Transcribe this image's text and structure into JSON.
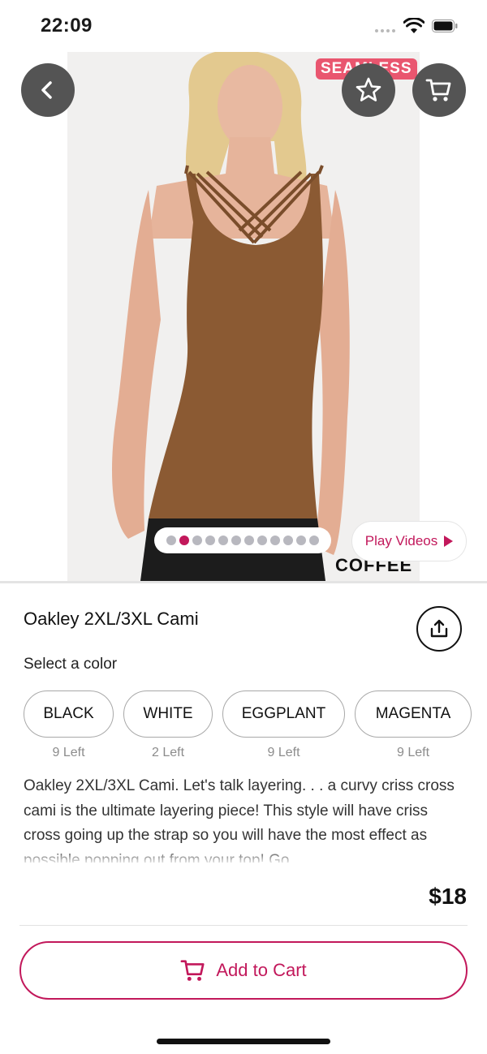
{
  "status_bar": {
    "time": "22:09"
  },
  "hero": {
    "image_tag": "SEAMLESS",
    "image_color_label": "COFFEE",
    "icons": {
      "back": "chevron-left-icon",
      "favorite": "star-icon",
      "cart": "cart-icon"
    },
    "carousel": {
      "total": 12,
      "active_index": 1
    },
    "play_videos_label": "Play Videos"
  },
  "product": {
    "title": "Oakley 2XL/3XL Cami",
    "select_color_label": "Select a color",
    "colors": [
      {
        "name": "BLACK",
        "stock": "9 Left"
      },
      {
        "name": "WHITE",
        "stock": "2 Left"
      },
      {
        "name": "EGGPLANT",
        "stock": "9 Left"
      },
      {
        "name": "MAGENTA",
        "stock": "9 Left"
      }
    ],
    "description": "Oakley 2XL/3XL Cami. Let's talk layering. . . a curvy criss cross cami is the ultimate layering piece! This style will have criss cross going up the strap so you will have the most effect as possible popping out from your top! Go"
  },
  "footer": {
    "price": "$18",
    "add_to_cart_label": "Add to Cart"
  },
  "theme": {
    "accent": "#c2185b",
    "icon_button_bg": "#545454",
    "garment": "#8b5a33"
  }
}
